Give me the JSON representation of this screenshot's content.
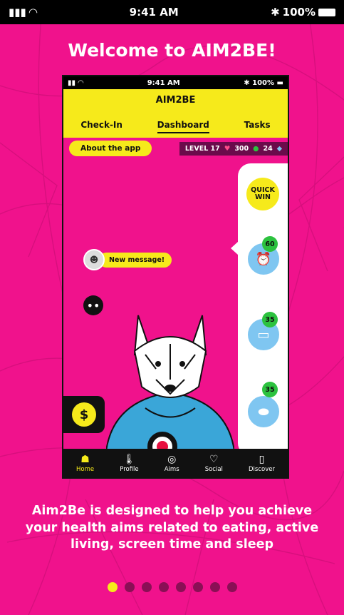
{
  "status_bar": {
    "time": "9:41 AM",
    "battery": "100%",
    "signal_icon": "signal-icon",
    "wifi_icon": "wifi-icon",
    "bluetooth_icon": "bluetooth-icon"
  },
  "welcome_title": "Welcome to AIM2BE!",
  "phone": {
    "status_bar": {
      "time": "9:41 AM",
      "battery": "100%"
    },
    "app_title": "AIM2BE",
    "tabs": [
      {
        "label": "Check-In"
      },
      {
        "label": "Dashboard",
        "active": true
      },
      {
        "label": "Tasks"
      }
    ],
    "about_button": "About the app",
    "stats": {
      "level": "LEVEL 17",
      "points": "300",
      "coins": "24"
    },
    "quick_win": {
      "line1": "QUICK",
      "line2": "WIN"
    },
    "aims": [
      {
        "reward": "60",
        "icon": "alarm-clock-icon"
      },
      {
        "reward": "35",
        "icon": "bed-icon"
      },
      {
        "reward": "35",
        "icon": "shoe-icon"
      }
    ],
    "message_bubble": "New message!",
    "bottom_nav": [
      {
        "label": "Home",
        "active": true,
        "icon": "home-avatar-icon"
      },
      {
        "label": "Profile",
        "icon": "thermometer-icon"
      },
      {
        "label": "Aims",
        "icon": "target-hand-icon"
      },
      {
        "label": "Social",
        "icon": "heart-icon"
      },
      {
        "label": "Discover",
        "icon": "card-icon"
      }
    ]
  },
  "description": "Aim2Be is designed to help you achieve your health aims related to eating, active living, screen time and sleep",
  "pagination": {
    "total": 8,
    "active_index": 0
  },
  "colors": {
    "background": "#f0128c",
    "accent": "#f6ea1b",
    "nav": "#111111"
  }
}
